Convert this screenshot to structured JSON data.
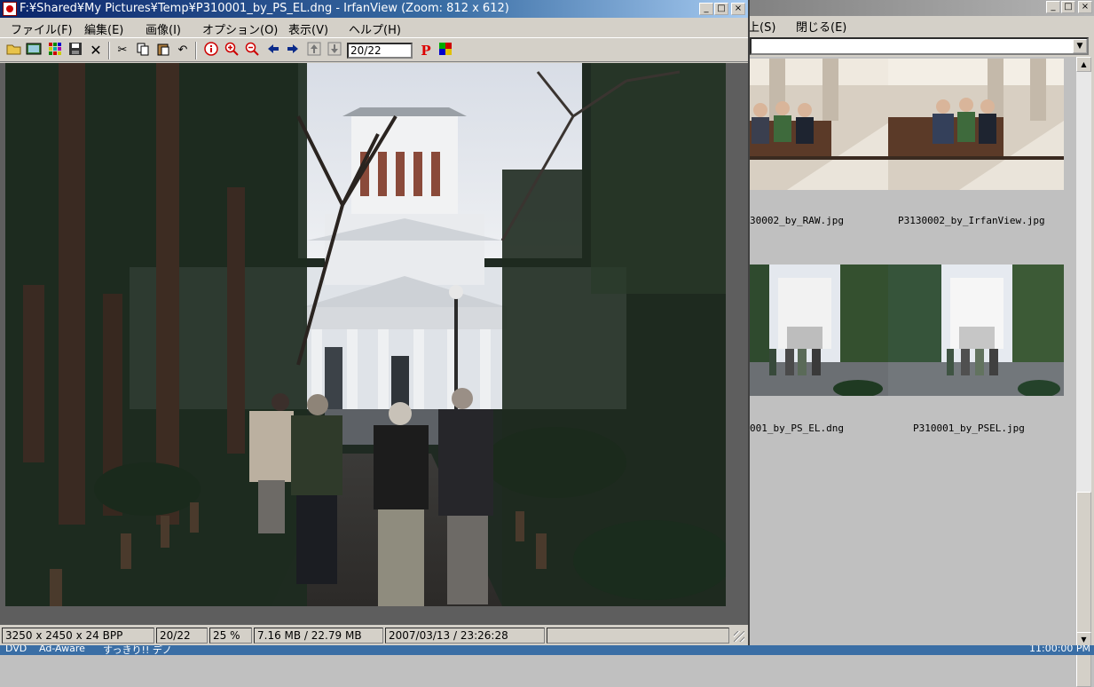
{
  "main_window": {
    "title": "F:¥Shared¥My Pictures¥Temp¥P310001_by_PS_EL.dng - IrfanView (Zoom: 812 x 612)",
    "menu": [
      "ファイル(F)",
      "編集(E)",
      "画像(I)",
      "オプション(O)",
      "表示(V)",
      "ヘルプ(H)"
    ],
    "toolbar": {
      "open": "open-folder-icon",
      "thumbnails": "thumbnails-icon",
      "slideshow": "slideshow-icon",
      "save": "save-icon",
      "delete": "delete-icon",
      "cut": "cut-icon",
      "copy": "copy-icon",
      "paste": "paste-icon",
      "undo": "undo-icon",
      "info": "info-icon",
      "zoom_in": "zoom-in-icon",
      "zoom_out": "zoom-out-icon",
      "prev": "prev-arrow-icon",
      "next": "next-arrow-icon",
      "first": "first-file-icon",
      "last": "last-file-icon",
      "page_value": "20/22",
      "paint": "P",
      "color": "color-icon"
    },
    "status": {
      "dimensions": "3250 x 2450 x 24 BPP",
      "index": "20/22",
      "zoom": "25 %",
      "size": "7.16 MB / 22.79 MB",
      "datetime": "2007/03/13 / 23:26:28"
    }
  },
  "background_window": {
    "menu_partial": [
      "上(S)",
      "閉じる(E)"
    ],
    "thumbnails": [
      {
        "label": "30002_by_RAW.jpg"
      },
      {
        "label": "P3130002_by_IrfanView.jpg"
      },
      {
        "label": "001_by_PS_EL.dng"
      },
      {
        "label": "P310001_by_PSEL.jpg"
      }
    ]
  },
  "taskbar": {
    "items": [
      "DVD",
      "Ad-Aware",
      "すっきり!! デノ"
    ],
    "clock": "11:00:00 PM"
  }
}
